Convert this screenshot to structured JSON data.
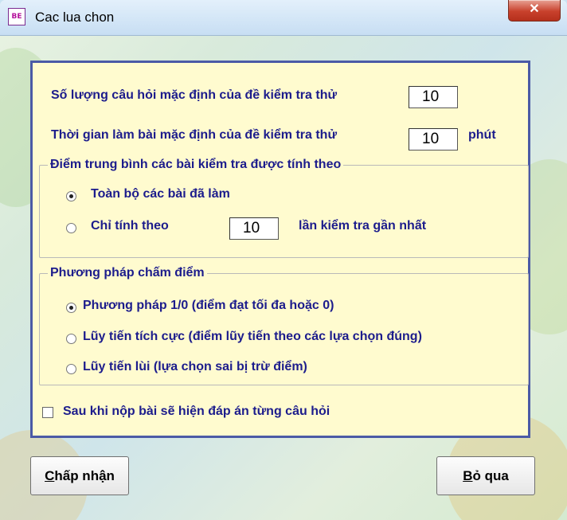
{
  "window": {
    "title": "Cac lua chon",
    "icon_text": "BE",
    "close_label": "✕"
  },
  "settings": {
    "default_questions_label": "Số lượng câu hỏi mặc định của đề kiểm tra thử",
    "default_questions_value": "10",
    "default_time_label": "Thời gian làm bài mặc định của đề kiểm tra thử",
    "default_time_value": "10",
    "default_time_unit": "phút"
  },
  "average_group": {
    "legend": "Điểm trung bình các bài kiểm tra được tính theo",
    "option_all": "Toàn bộ các bài đã làm",
    "option_recent_prefix": "Chỉ tính theo",
    "option_recent_value": "10",
    "option_recent_suffix": "lần kiểm tra gần nhất",
    "selected": "all"
  },
  "scoring_group": {
    "legend": "Phương pháp chấm điểm",
    "options": [
      "Phương pháp 1/0 (điểm đạt tối đa hoặc 0)",
      "Lũy tiến tích cực (điểm lũy tiến theo các lựa chọn đúng)",
      "Lũy tiến lùi (lựa chọn sai bị trừ điểm)"
    ],
    "selected_index": 0
  },
  "show_answers": {
    "label": "Sau khi nộp bài sẽ hiện đáp án từng câu hỏi",
    "checked": false
  },
  "buttons": {
    "accept_hotkey": "C",
    "accept_rest": "hấp nhận",
    "cancel_hotkey": "B",
    "cancel_rest": "ỏ qua"
  },
  "colors": {
    "panel_bg": "#fffbcf",
    "panel_border": "#4b5aa6",
    "label_text": "#1c1c8c",
    "close_button": "#c8412c"
  }
}
